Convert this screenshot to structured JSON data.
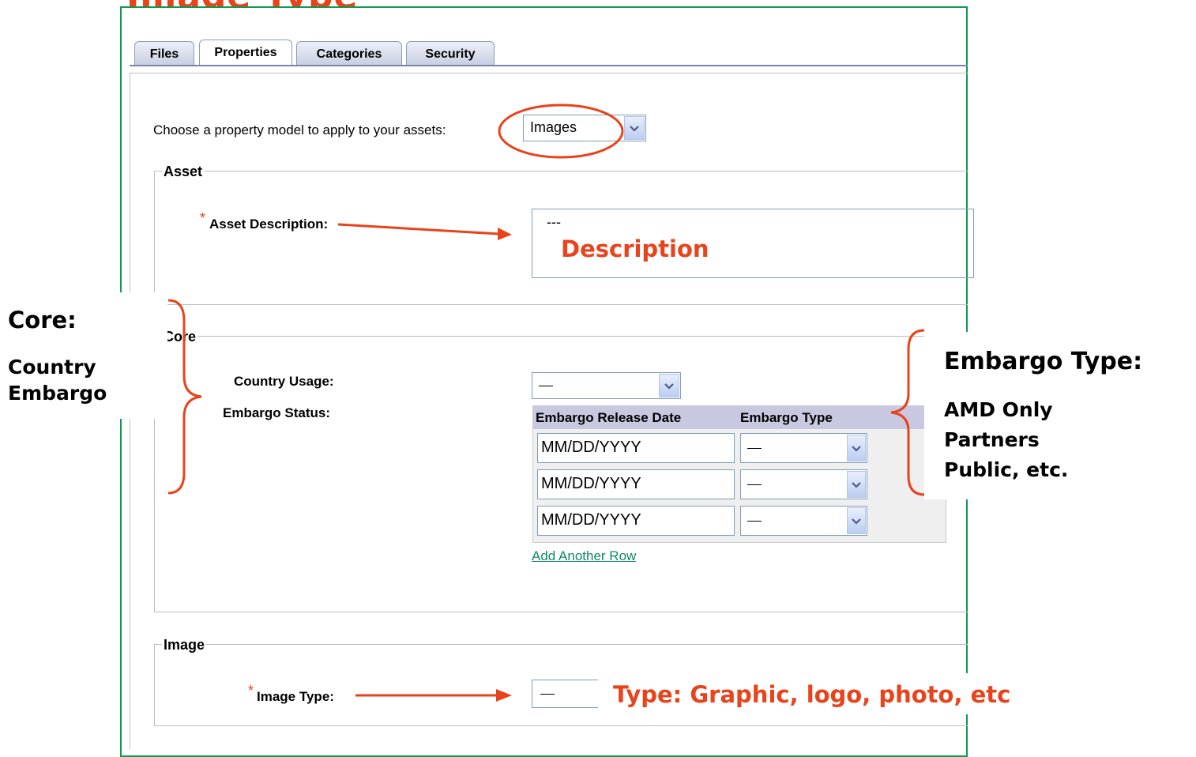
{
  "slide": {
    "title": "Image Type"
  },
  "tabs": [
    {
      "label": "Files"
    },
    {
      "label": "Properties"
    },
    {
      "label": "Categories"
    },
    {
      "label": "Security"
    }
  ],
  "property_model": {
    "label": "Choose a property model to apply to your assets:",
    "value": "Images"
  },
  "asset_section": {
    "legend": "Asset",
    "required_mark": "*",
    "description_label": "Asset Description:",
    "description_value": "---"
  },
  "core_section": {
    "legend": "Core",
    "country_usage_label": "Country Usage:",
    "embargo_status_label": "Embargo Status:",
    "table_headers": [
      "Embargo Release Date",
      "Embargo Type"
    ],
    "rows": [
      {
        "date_placeholder": "MM/DD/YYYY"
      },
      {
        "date_placeholder": "MM/DD/YYYY"
      },
      {
        "date_placeholder": "MM/DD/YYYY"
      }
    ],
    "add_row_link": "Add Another Row"
  },
  "image_section": {
    "legend": "Image",
    "required_mark": "*",
    "image_type_label": "Image Type:"
  },
  "annotations": {
    "description": "Description",
    "core_title": "Core:",
    "core_items": [
      "Country",
      "Embargo"
    ],
    "embargo_title": "Embargo Type:",
    "embargo_items": [
      "AMD Only",
      "Partners",
      "Public, etc."
    ],
    "type_note": "Type:  Graphic, logo, photo, etc"
  },
  "colors": {
    "annotation": "#e8431a",
    "frame": "#119a4e",
    "link": "#0e8a6a"
  }
}
